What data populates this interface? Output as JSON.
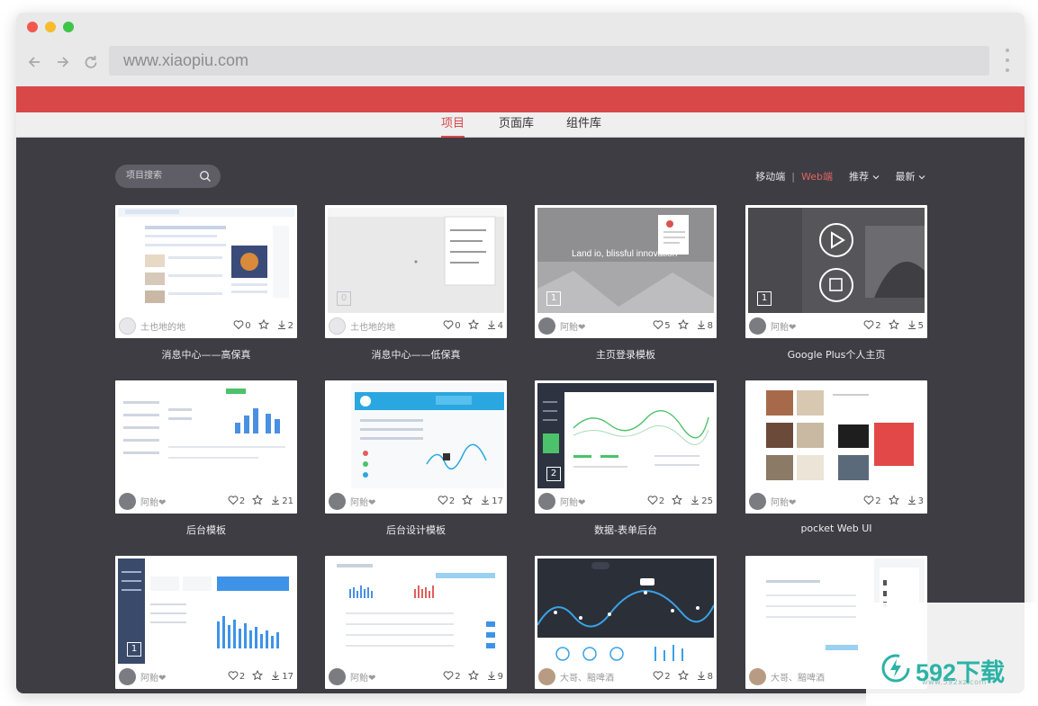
{
  "browser": {
    "url": "www.xiaopiu.com"
  },
  "tabs": [
    {
      "label": "项目",
      "active": true
    },
    {
      "label": "页面库",
      "active": false
    },
    {
      "label": "组件库",
      "active": false
    }
  ],
  "toolbar": {
    "search_placeholder": "项目搜索",
    "mobile": "移动端",
    "separator": "|",
    "web": "Web端",
    "recommend": "推荐",
    "newest": "最新"
  },
  "cards": [
    {
      "title": "消息中心——高保真",
      "author": "土也地的地",
      "likes": "0",
      "favorites": "",
      "downloads": "2",
      "badge": ""
    },
    {
      "title": "消息中心——低保真",
      "author": "土也地的地",
      "likes": "0",
      "favorites": "",
      "downloads": "4",
      "badge": "0"
    },
    {
      "title": "主页登录模板",
      "author": "阿鲐❤",
      "likes": "5",
      "favorites": "",
      "downloads": "8",
      "badge": "1",
      "overlay": "Land io, blissful innovation"
    },
    {
      "title": "Google Plus个人主页",
      "author": "阿鲐❤",
      "likes": "2",
      "favorites": "",
      "downloads": "5",
      "badge": "1"
    },
    {
      "title": "后台模板",
      "author": "阿鲐❤",
      "likes": "2",
      "favorites": "",
      "downloads": "21",
      "badge": ""
    },
    {
      "title": "后台设计模板",
      "author": "阿鲐❤",
      "likes": "2",
      "favorites": "",
      "downloads": "17",
      "badge": ""
    },
    {
      "title": "数据-表单后台",
      "author": "阿鲐❤",
      "likes": "2",
      "favorites": "",
      "downloads": "25",
      "badge": "2"
    },
    {
      "title": "pocket Web UI",
      "author": "阿鲐❤",
      "likes": "2",
      "favorites": "",
      "downloads": "3",
      "badge": ""
    },
    {
      "title": "",
      "author": "阿鲐❤",
      "likes": "2",
      "favorites": "",
      "downloads": "17",
      "badge": "1"
    },
    {
      "title": "",
      "author": "阿鲐❤",
      "likes": "2",
      "favorites": "",
      "downloads": "9",
      "badge": ""
    },
    {
      "title": "",
      "author": "大哥、黯啤酒",
      "likes": "2",
      "favorites": "",
      "downloads": "8",
      "badge": ""
    },
    {
      "title": "",
      "author": "大哥、黯啤酒",
      "likes": "",
      "favorites": "",
      "downloads": "",
      "badge": ""
    }
  ],
  "watermark": {
    "text": "592下载",
    "url": "www.592xz.com"
  },
  "colors": {
    "brand_red": "#d94848",
    "content_bg": "#3e3d43",
    "watermark_teal": "#2bb3a6"
  }
}
